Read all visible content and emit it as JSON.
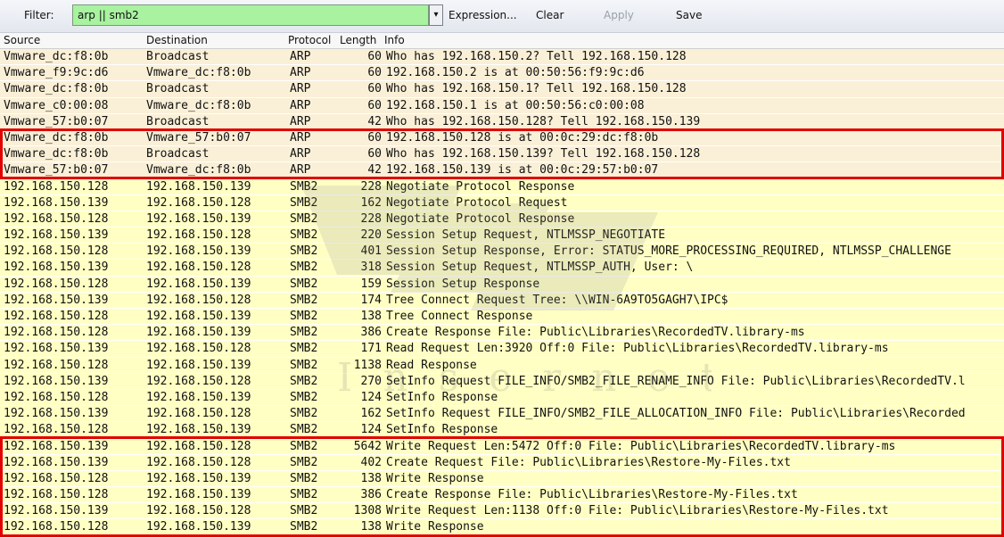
{
  "toolbar": {
    "filter_label": "Filter:",
    "filter_value": "arp || smb2",
    "dropdown_glyph": "▾",
    "expression_label": "Expression...",
    "clear_label": "Clear",
    "apply_label": "Apply",
    "save_label": "Save"
  },
  "columns": {
    "source": "Source",
    "destination": "Destination",
    "protocol": "Protocol",
    "length": "Length",
    "info": "Info"
  },
  "colors": {
    "arp_row": "#faf0d7",
    "smb_row": "#ffffc4",
    "filter_valid": "#a8f2a0",
    "highlight_box": "#e00000"
  },
  "watermark": {
    "text": "I n s e r n e t"
  },
  "packets": [
    {
      "src": "Vmware_dc:f8:0b",
      "dst": "Broadcast",
      "proto": "ARP",
      "len": "60",
      "info": "Who has 192.168.150.2?  Tell 192.168.150.128"
    },
    {
      "src": "Vmware_f9:9c:d6",
      "dst": "Vmware_dc:f8:0b",
      "proto": "ARP",
      "len": "60",
      "info": "192.168.150.2 is at 00:50:56:f9:9c:d6"
    },
    {
      "src": "Vmware_dc:f8:0b",
      "dst": "Broadcast",
      "proto": "ARP",
      "len": "60",
      "info": "Who has 192.168.150.1?  Tell 192.168.150.128"
    },
    {
      "src": "Vmware_c0:00:08",
      "dst": "Vmware_dc:f8:0b",
      "proto": "ARP",
      "len": "60",
      "info": "192.168.150.1 is at 00:50:56:c0:00:08"
    },
    {
      "src": "Vmware_57:b0:07",
      "dst": "Broadcast",
      "proto": "ARP",
      "len": "42",
      "info": "Who has 192.168.150.128?  Tell 192.168.150.139"
    },
    {
      "src": "Vmware_dc:f8:0b",
      "dst": "Vmware_57:b0:07",
      "proto": "ARP",
      "len": "60",
      "info": "192.168.150.128 is at 00:0c:29:dc:f8:0b"
    },
    {
      "src": "Vmware_dc:f8:0b",
      "dst": "Broadcast",
      "proto": "ARP",
      "len": "60",
      "info": "Who has 192.168.150.139?  Tell 192.168.150.128"
    },
    {
      "src": "Vmware_57:b0:07",
      "dst": "Vmware_dc:f8:0b",
      "proto": "ARP",
      "len": "42",
      "info": "192.168.150.139 is at 00:0c:29:57:b0:07"
    },
    {
      "src": "192.168.150.128",
      "dst": "192.168.150.139",
      "proto": "SMB2",
      "len": "228",
      "info": "Negotiate Protocol Response"
    },
    {
      "src": "192.168.150.139",
      "dst": "192.168.150.128",
      "proto": "SMB2",
      "len": "162",
      "info": "Negotiate Protocol Request"
    },
    {
      "src": "192.168.150.128",
      "dst": "192.168.150.139",
      "proto": "SMB2",
      "len": "228",
      "info": "Negotiate Protocol Response"
    },
    {
      "src": "192.168.150.139",
      "dst": "192.168.150.128",
      "proto": "SMB2",
      "len": "220",
      "info": "Session Setup Request, NTLMSSP_NEGOTIATE"
    },
    {
      "src": "192.168.150.128",
      "dst": "192.168.150.139",
      "proto": "SMB2",
      "len": "401",
      "info": "Session Setup Response, Error: STATUS_MORE_PROCESSING_REQUIRED, NTLMSSP_CHALLENGE"
    },
    {
      "src": "192.168.150.139",
      "dst": "192.168.150.128",
      "proto": "SMB2",
      "len": "318",
      "info": "Session Setup Request, NTLMSSP_AUTH, User: \\"
    },
    {
      "src": "192.168.150.128",
      "dst": "192.168.150.139",
      "proto": "SMB2",
      "len": "159",
      "info": "Session Setup Response"
    },
    {
      "src": "192.168.150.139",
      "dst": "192.168.150.128",
      "proto": "SMB2",
      "len": "174",
      "info": "Tree Connect Request Tree: \\\\WIN-6A9TO5GAGH7\\IPC$"
    },
    {
      "src": "192.168.150.128",
      "dst": "192.168.150.139",
      "proto": "SMB2",
      "len": "138",
      "info": "Tree Connect Response"
    },
    {
      "src": "192.168.150.128",
      "dst": "192.168.150.139",
      "proto": "SMB2",
      "len": "386",
      "info": "Create Response File: Public\\Libraries\\RecordedTV.library-ms"
    },
    {
      "src": "192.168.150.139",
      "dst": "192.168.150.128",
      "proto": "SMB2",
      "len": "171",
      "info": "Read Request Len:3920 Off:0 File: Public\\Libraries\\RecordedTV.library-ms"
    },
    {
      "src": "192.168.150.128",
      "dst": "192.168.150.139",
      "proto": "SMB2",
      "len": "1138",
      "info": "Read Response"
    },
    {
      "src": "192.168.150.139",
      "dst": "192.168.150.128",
      "proto": "SMB2",
      "len": "270",
      "info": "SetInfo Request FILE_INFO/SMB2_FILE_RENAME_INFO File: Public\\Libraries\\RecordedTV.l"
    },
    {
      "src": "192.168.150.128",
      "dst": "192.168.150.139",
      "proto": "SMB2",
      "len": "124",
      "info": "SetInfo Response"
    },
    {
      "src": "192.168.150.139",
      "dst": "192.168.150.128",
      "proto": "SMB2",
      "len": "162",
      "info": "SetInfo Request FILE_INFO/SMB2_FILE_ALLOCATION_INFO File: Public\\Libraries\\Recorded"
    },
    {
      "src": "192.168.150.128",
      "dst": "192.168.150.139",
      "proto": "SMB2",
      "len": "124",
      "info": "SetInfo Response"
    },
    {
      "src": "192.168.150.139",
      "dst": "192.168.150.128",
      "proto": "SMB2",
      "len": "5642",
      "info": "Write Request Len:5472 Off:0 File: Public\\Libraries\\RecordedTV.library-ms"
    },
    {
      "src": "192.168.150.139",
      "dst": "192.168.150.128",
      "proto": "SMB2",
      "len": "402",
      "info": "Create Request File: Public\\Libraries\\Restore-My-Files.txt"
    },
    {
      "src": "192.168.150.128",
      "dst": "192.168.150.139",
      "proto": "SMB2",
      "len": "138",
      "info": "Write Response"
    },
    {
      "src": "192.168.150.128",
      "dst": "192.168.150.139",
      "proto": "SMB2",
      "len": "386",
      "info": "Create Response File: Public\\Libraries\\Restore-My-Files.txt"
    },
    {
      "src": "192.168.150.139",
      "dst": "192.168.150.128",
      "proto": "SMB2",
      "len": "1308",
      "info": "Write Request Len:1138 Off:0 File: Public\\Libraries\\Restore-My-Files.txt"
    },
    {
      "src": "192.168.150.128",
      "dst": "192.168.150.139",
      "proto": "SMB2",
      "len": "138",
      "info": "Write Response"
    }
  ]
}
